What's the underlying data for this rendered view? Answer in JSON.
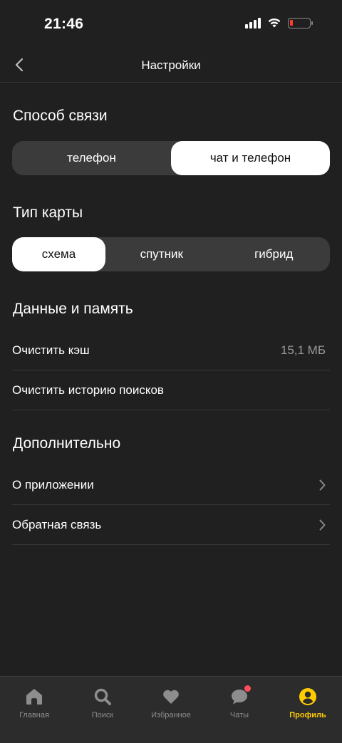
{
  "status_bar": {
    "time": "21:46"
  },
  "header": {
    "title": "Настройки"
  },
  "contact_method": {
    "title": "Способ связи",
    "options": [
      "телефон",
      "чат и телефон"
    ],
    "selected": "чат и телефон"
  },
  "map_type": {
    "title": "Тип карты",
    "options": [
      "схема",
      "спутник",
      "гибрид"
    ],
    "selected": "схема"
  },
  "data_memory": {
    "title": "Данные и память",
    "clear_cache": {
      "label": "Очистить кэш",
      "value": "15,1 МБ"
    },
    "clear_history": {
      "label": "Очистить историю поисков"
    }
  },
  "additional": {
    "title": "Дополнительно",
    "about": {
      "label": "О приложении"
    },
    "feedback": {
      "label": "Обратная связь"
    }
  },
  "tab_bar": {
    "items": [
      {
        "label": "Главная",
        "icon": "home-icon"
      },
      {
        "label": "Поиск",
        "icon": "search-icon"
      },
      {
        "label": "Избранное",
        "icon": "heart-icon"
      },
      {
        "label": "Чаты",
        "icon": "chat-icon"
      },
      {
        "label": "Профиль",
        "icon": "profile-icon"
      }
    ],
    "active": "Профиль",
    "accent_color": "#ffcc00"
  }
}
